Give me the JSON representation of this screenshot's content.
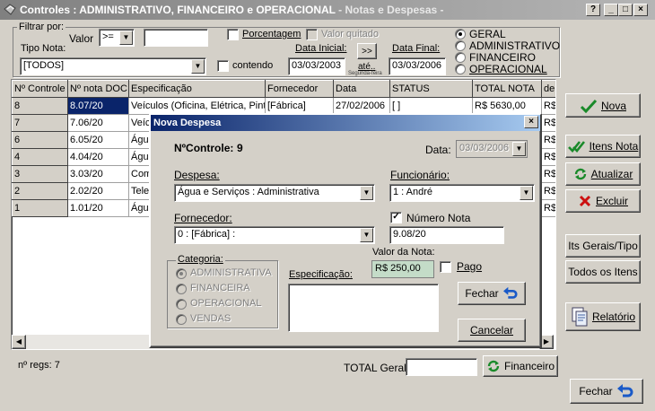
{
  "window": {
    "title": "Controles :  ADMINISTRATIVO, FINANCEIRO  e  OPERACIONAL",
    "subtitle": " - Notas e Despesas -",
    "controls": [
      "?",
      "_",
      "□",
      "×"
    ]
  },
  "filter": {
    "group_label": "Filtrar por:",
    "valor_label": "Valor",
    "operator": ">=",
    "valor_value": "",
    "porcentagem_label": "Porcentagem",
    "valor_quitado_label": "Valor quitado",
    "tipo_nota_label": "Tipo Nota:",
    "tipo_nota_value": "[TODOS]",
    "contendo_label": "contendo",
    "data_inicial_label": "Data Inicial:",
    "data_inicial": "03/03/2003",
    "data_final_label": "Data Final:",
    "data_final": "03/03/2006",
    "range_button": ">>",
    "ate_label": "até..",
    "segunda_label": "Segunda-feira",
    "radios": [
      {
        "label": "GERAL",
        "checked": true
      },
      {
        "label": "ADMINISTRATIVO",
        "checked": false
      },
      {
        "label": "FINANCEIRO",
        "checked": false
      },
      {
        "label": "OPERACIONAL",
        "checked": false
      }
    ]
  },
  "grid": {
    "columns": [
      "Nº  Controle",
      "Nº nota DOC",
      "Especificação",
      "Fornecedor",
      "Data",
      "STATUS",
      "TOTAL NOTA",
      "de"
    ],
    "rows": [
      [
        "8",
        "8.07/20",
        "Veículos (Oficina, Elétrica, Pintura)",
        "[Fábrica]",
        "27/02/2006",
        "[       ]",
        "R$  5630,00",
        "R$"
      ],
      [
        "7",
        "7.06/20",
        "Veíc",
        "",
        "",
        "",
        "",
        "R$"
      ],
      [
        "6",
        "6.05/20",
        "Água",
        "",
        "",
        "",
        "",
        "R$"
      ],
      [
        "4",
        "4.04/20",
        "Água",
        "",
        "",
        "",
        "",
        "R$"
      ],
      [
        "3",
        "3.03/20",
        "Com",
        "",
        "",
        "",
        "",
        "R$"
      ],
      [
        "2",
        "2.02/20",
        "Tele",
        "",
        "",
        "",
        "",
        "R$"
      ],
      [
        "1",
        "1.01/20",
        "Água",
        "",
        "",
        "",
        "",
        "R$"
      ]
    ]
  },
  "side_buttons": {
    "nova": "Nova",
    "itens_nota": "Itens Nota",
    "atualizar": "Atualizar",
    "excluir": "Excluir",
    "its_gerais": "Its Gerais/Tipo",
    "todos_itens": "Todos os Itens",
    "relatorio": "Relatório",
    "fechar": "Fechar"
  },
  "footer": {
    "nregs": "nº regs: 7",
    "total_geral_label": "TOTAL Geral:",
    "total_geral_value": "",
    "financeiro": "Financeiro"
  },
  "dialog": {
    "title": "Nova Despesa",
    "controle_label": "NºControle:",
    "controle_value": "9",
    "data_label": "Data:",
    "data_value": "03/03/2006",
    "despesa_label": "Despesa:",
    "despesa_value": "Água e Serviços : Administrativa",
    "funcionario_label": "Funcionário:",
    "funcionario_value": "1 : André",
    "fornecedor_label": "Fornecedor:",
    "fornecedor_value": "0 : [Fábrica] :",
    "numero_nota_label": "Número Nota",
    "numero_nota_value": "9.08/20",
    "categoria_label": "Categoria:",
    "categorias": [
      {
        "label": "ADMINISTRATIVA",
        "checked": true
      },
      {
        "label": "FINANCEIRA",
        "checked": false
      },
      {
        "label": "OPERACIONAL",
        "checked": false
      },
      {
        "label": "VENDAS",
        "checked": false
      }
    ],
    "especificacao_label": "Especificação:",
    "especificacao_value": "",
    "valor_nota_label": "Valor da Nota:",
    "valor_nota_value": "R$ 250,00",
    "pago_label": "Pago",
    "fechar": "Fechar",
    "cancelar": "Cancelar"
  }
}
